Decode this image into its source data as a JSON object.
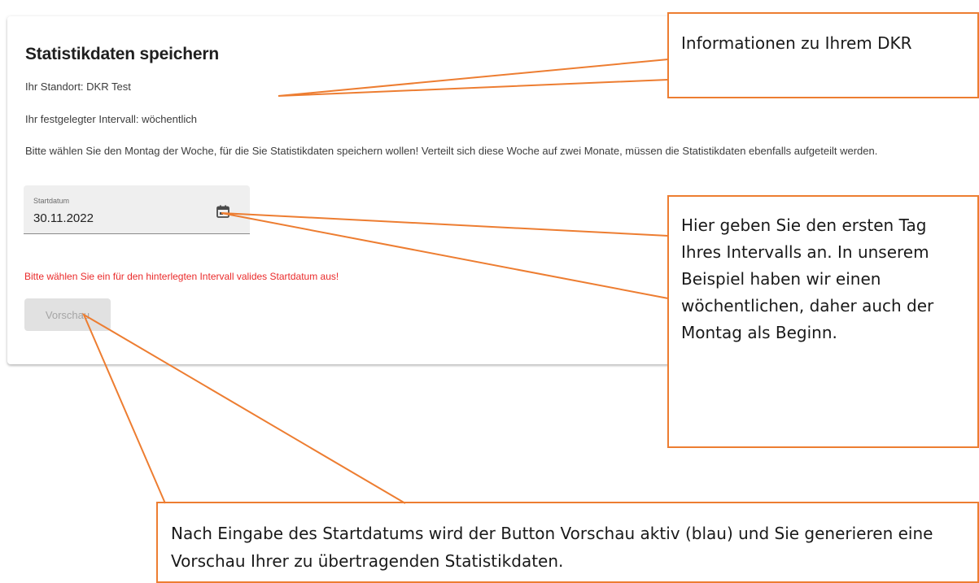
{
  "form": {
    "title": "Statistikdaten speichern",
    "standort": "Ihr Standort: DKR Test",
    "intervall": "Ihr festgelegter Intervall: wöchentlich",
    "instruction": "Bitte wählen Sie den Montag der Woche, für die Sie Statistikdaten speichern wollen! Verteilt sich diese Woche auf zwei Monate, müssen die Statistikdaten ebenfalls aufgeteilt werden.",
    "start_date": {
      "label": "Startdatum",
      "value": "30.11.2022",
      "icon": "calendar-icon"
    },
    "error": "Bitte wählen Sie ein für den hinterlegten Intervall valides Startdatum aus!",
    "preview_button": "Vorschau"
  },
  "callouts": {
    "info": "Informationen zu Ihrem DKR",
    "date_hint": "Hier geben Sie den ersten Tag Ihres Intervalls an. In unserem Beispiel haben wir einen wöchentlichen, daher auch der Montag als Beginn.",
    "preview_hint": "Nach Eingabe des Startdatums wird der Button Vorschau aktiv (blau) und Sie generieren eine Vorschau Ihrer zu übertragenden Statistikdaten."
  },
  "colors": {
    "callout_border": "#ed7d31",
    "error": "#ea2a2a",
    "disabled_button": "#e1e1e1"
  }
}
